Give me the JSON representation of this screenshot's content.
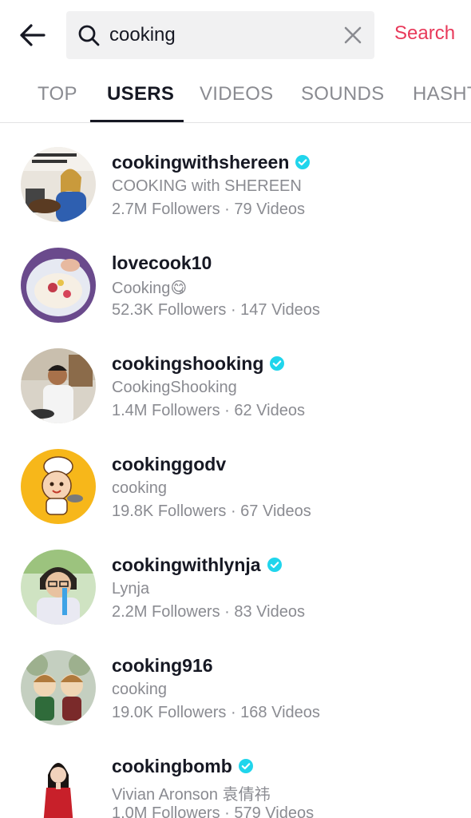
{
  "header": {
    "search_value": "cooking",
    "search_button": "Search"
  },
  "tabs": [
    {
      "label": "TOP"
    },
    {
      "label": "USERS"
    },
    {
      "label": "VIDEOS"
    },
    {
      "label": "SOUNDS"
    },
    {
      "label": "HASHT"
    }
  ],
  "active_tab": "USERS",
  "users": [
    {
      "username": "cookingwithshereen",
      "verified": true,
      "nickname": "COOKING with SHEREEN",
      "stats": "2.7M Followers · 79 Videos"
    },
    {
      "username": "lovecook10",
      "verified": false,
      "nickname": "Cooking😋",
      "stats": "52.3K Followers · 147 Videos"
    },
    {
      "username": "cookingshooking",
      "verified": true,
      "nickname": "CookingShooking",
      "stats": "1.4M Followers · 62 Videos"
    },
    {
      "username": "cookinggodv",
      "verified": false,
      "nickname": "cooking",
      "stats": "19.8K Followers · 67 Videos"
    },
    {
      "username": "cookingwithlynja",
      "verified": true,
      "nickname": "Lynja",
      "stats": "2.2M Followers · 83 Videos"
    },
    {
      "username": "cooking916",
      "verified": false,
      "nickname": "cooking",
      "stats": "19.0K Followers · 168 Videos"
    },
    {
      "username": "cookingbomb",
      "verified": true,
      "nickname": "Vivian Aronson 袁倩祎",
      "stats": "1.0M Followers · 579 Videos"
    }
  ],
  "colors": {
    "accent": "#e8395a",
    "verified": "#20d5ec",
    "text_primary": "#161823",
    "text_secondary": "#8a8b91"
  }
}
